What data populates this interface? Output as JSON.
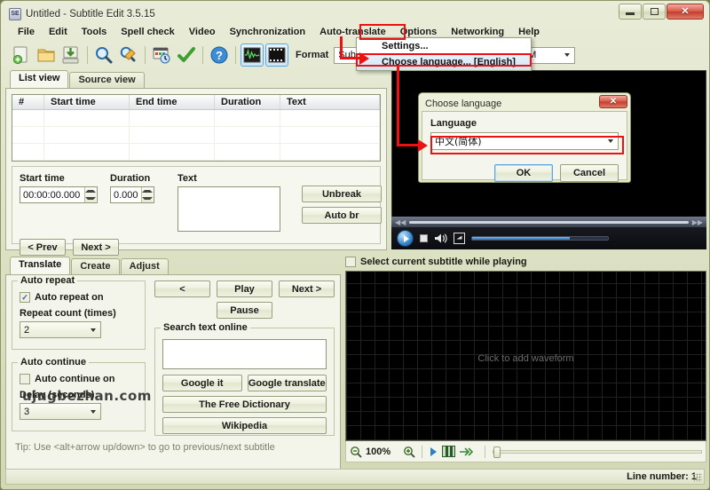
{
  "window": {
    "title": "Untitled - Subtitle Edit 3.5.15",
    "app_icon": "subtitle-edit-icon",
    "minimize": "–",
    "maximize": "□",
    "close": "✕"
  },
  "menubar": {
    "items": [
      {
        "label": "File"
      },
      {
        "label": "Edit"
      },
      {
        "label": "Tools"
      },
      {
        "label": "Spell check"
      },
      {
        "label": "Video"
      },
      {
        "label": "Synchronization"
      },
      {
        "label": "Auto-translate"
      },
      {
        "label": "Options"
      },
      {
        "label": "Networking"
      },
      {
        "label": "Help"
      }
    ]
  },
  "options_menu": {
    "items": [
      {
        "label": "Settings...",
        "highlighted": false
      },
      {
        "label": "Choose language... [English]",
        "highlighted": true
      }
    ]
  },
  "toolbar": {
    "icons": [
      {
        "name": "new-icon"
      },
      {
        "name": "open-icon"
      },
      {
        "name": "save-icon"
      },
      {
        "name": "find-icon"
      },
      {
        "name": "replace-icon"
      },
      {
        "name": "sync-icon"
      },
      {
        "name": "spell-check-icon"
      },
      {
        "name": "help-icon"
      },
      {
        "name": "waveform-toggle-icon"
      },
      {
        "name": "video-toggle-icon"
      }
    ],
    "format_label": "Format",
    "format_value": "SubRip",
    "encoding_value": "BOM"
  },
  "view_tabs": [
    {
      "label": "List view",
      "active": true
    },
    {
      "label": "Source view",
      "active": false
    }
  ],
  "listview": {
    "columns": [
      "#",
      "Start time",
      "End time",
      "Duration",
      "Text"
    ],
    "rows": []
  },
  "editor": {
    "start_time_label": "Start time",
    "start_time_value": "00:00:00.000",
    "duration_label": "Duration",
    "duration_value": "0.000",
    "text_label": "Text",
    "text_value": "",
    "unbreak_label": "Unbreak",
    "auto_br_label": "Auto br",
    "prev_label": "< Prev",
    "next_label": "Next >"
  },
  "mode_tabs": [
    {
      "label": "Translate",
      "active": true
    },
    {
      "label": "Create",
      "active": false
    },
    {
      "label": "Adjust",
      "active": false
    }
  ],
  "translate": {
    "auto_repeat_legend": "Auto repeat",
    "auto_repeat_checkbox": "Auto repeat on",
    "auto_repeat_checked": true,
    "repeat_count_label": "Repeat count (times)",
    "repeat_count_value": "2",
    "auto_continue_legend": "Auto continue",
    "auto_continue_checkbox": "Auto continue on",
    "auto_continue_checked": false,
    "delay_label": "Delay (seconds)",
    "delay_value": "3",
    "prev_label": "<",
    "play_label": "Play",
    "next_label": "Next >",
    "pause_label": "Pause",
    "search_legend": "Search text online",
    "search_value": "",
    "google_it_label": "Google it",
    "google_translate_label": "Google translate",
    "free_dictionary_label": "The Free Dictionary",
    "wikipedia_label": "Wikipedia",
    "tip": "Tip: Use <alt+arrow up/down> to go to previous/next subtitle"
  },
  "video": {
    "play_icon": "play-icon",
    "stop_icon": "stop-icon",
    "volume_icon": "volume-icon",
    "fullscreen_icon": "fullscreen-icon",
    "rewind_icon": "rewind-icon",
    "forward_icon": "forward-icon"
  },
  "waveform": {
    "select_checkbox": "Select current subtitle while playing",
    "select_checked": false,
    "hint": "Click to add waveform",
    "zoom_out_icon": "zoom-out-icon",
    "zoom_value": "100%",
    "zoom_in_icon": "zoom-in-icon",
    "play_icon": "play-icon",
    "grid_icon": "grid-icon",
    "speed_icon": "playback-speed-icon"
  },
  "statusbar": {
    "line_number": "Line number: 1"
  },
  "dialog": {
    "title": "Choose language",
    "close": "✕",
    "language_label": "Language",
    "language_value": "中文(简体)",
    "ok_label": "OK",
    "cancel_label": "Cancel"
  },
  "watermark": {
    "text": "ujngbezhan.com"
  },
  "colors": {
    "annotation": "#ee1111",
    "accent": "#59a6de",
    "close_button": "#c23d2c"
  }
}
